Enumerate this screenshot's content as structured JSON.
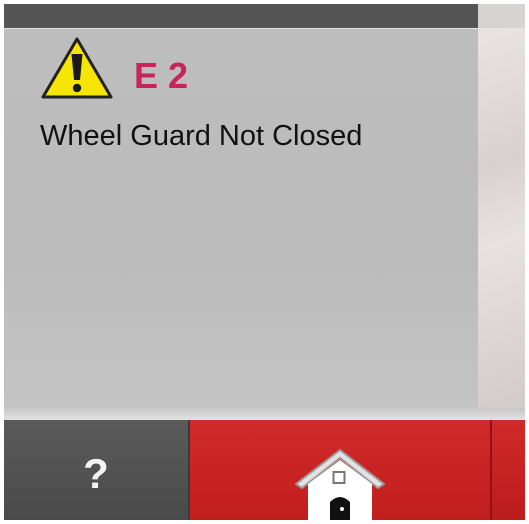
{
  "alert": {
    "code": "E 2",
    "message": "Wheel Guard Not Closed",
    "icon": "warning-triangle-icon",
    "code_color": "#c8245a",
    "icon_color": "#f6e500"
  },
  "toolbar": {
    "help_label": "?",
    "home_icon": "home-icon",
    "accent_color": "#c8202a"
  }
}
